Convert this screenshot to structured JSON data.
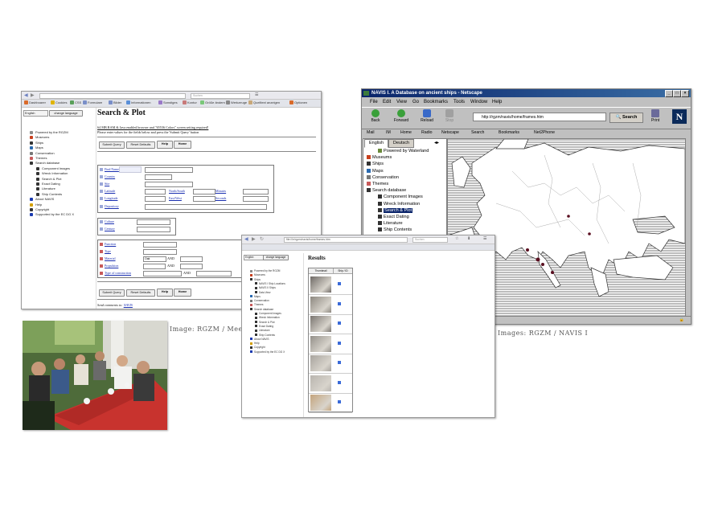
{
  "captions": {
    "photo": "Image: RGZM / Mees",
    "netscape": "Images: RGZM / NAVIS I"
  },
  "shot1": {
    "search_placeholder": "Suchen",
    "bookmarks": [
      "Dashboarer",
      "Cookies",
      "CSS",
      "Formulare",
      "Bilder",
      "Informationen",
      "Sonstiges",
      "Kontur",
      "Größe ändern",
      "Werkzeuge",
      "Quelltext anzeigen",
      "Optionen"
    ],
    "language": "English",
    "change_language": "change language",
    "nav": [
      "Powered by the RGZM",
      "Museums",
      "Ships",
      "Maps",
      "Conservation",
      "Themes",
      "Search database",
      "Component Images",
      "Wreck Information",
      "Search & Plot",
      "Exact Dating",
      "Literature",
      "Ship Contents",
      "About NAVIS",
      "Help",
      "Copyright",
      "Supported by the EC DG X"
    ],
    "title": "Search & Plot",
    "notice_link": "64 MB RAM & Java enabled browser and \"65536 Colors\" screen setting required!",
    "notice_text": "Please enter values for the fields below and press the 'Submit Query' button",
    "buttons": {
      "submit": "Submit Query",
      "reset": "Reset Defaults",
      "help": "Help",
      "home": "Home"
    },
    "fields_a": [
      "Find Name",
      "Country",
      "Site",
      "Latitude",
      "Longitude",
      "Depository"
    ],
    "north_south": "North/South",
    "east_west": "East/West",
    "minutes": "Minutes",
    "seconds": "Seconds",
    "fields_b": [
      "Culture",
      "Century"
    ],
    "fields_c": [
      "Function",
      "Type",
      "Material",
      "Propulsion",
      "Type of construction"
    ],
    "and_label": "AND",
    "oak": "Oak",
    "send_comments": "Send comments to:",
    "send_link": "NAVIS"
  },
  "shot2": {
    "window_title": "NAVIS I. A Database on ancient ships - Netscape",
    "menu": [
      "File",
      "Edit",
      "View",
      "Go",
      "Bookmarks",
      "Tools",
      "Window",
      "Help"
    ],
    "toolbar": [
      "Back",
      "Forward",
      "Reload",
      "Stop",
      "Print"
    ],
    "url": "http://rgzm/navis/home/frames.htm",
    "search_btn": "Search",
    "personal": [
      "Mail",
      "IM",
      "Home",
      "Radio",
      "Netscape",
      "Search",
      "Bookmarks",
      "Net2Phone"
    ],
    "tabs": [
      "English",
      "Deutsch"
    ],
    "tree": [
      "Powered by Waterland",
      "Museums",
      "Ships",
      "Maps",
      "Conservation",
      "Themes",
      "Search database",
      "Component Images",
      "Wreck Information",
      "Search & Plot",
      "Exact Dating",
      "Literature",
      "Ship Contents"
    ]
  },
  "shot3": {
    "url": "file:///e/rgzm/navis/home/frames.htm",
    "search_placeholder": "Suchen",
    "language": "English",
    "change_language": "change language",
    "nav": [
      "Powered by the RGZM",
      "Museums",
      "Ships",
      "NAVIS I Ship Locations",
      "NAVIS II Ships",
      "Data View",
      "Maps",
      "Conservation",
      "Themes",
      "Search database",
      "Component Images",
      "Wreck Information",
      "Search & Plot",
      "Exact Dating",
      "Literature",
      "Ship Contents",
      "About NAVIS",
      "Help",
      "Copyright",
      "Supported by the EC DG X"
    ],
    "results_title": "Results",
    "col_thumbnail": "Thumbnail",
    "col_ship": "Ship / ID"
  },
  "colors": {
    "link": "#1a2fb0",
    "netscape_title": "#0a246a",
    "selected": "#0a246a"
  }
}
